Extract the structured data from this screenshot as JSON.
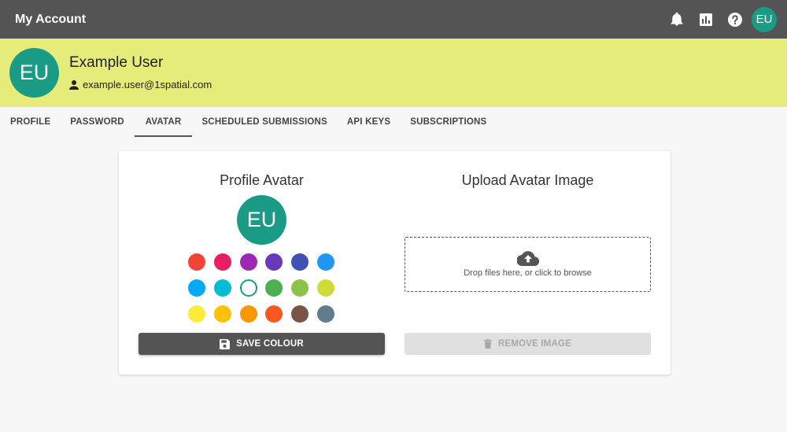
{
  "app": {
    "title": "My Account"
  },
  "topbar": {
    "icons": [
      "bell-icon",
      "chart-icon",
      "help-icon"
    ],
    "avatar_initials": "EU",
    "avatar_color": "#1a9b86"
  },
  "user": {
    "initials": "EU",
    "name": "Example User",
    "email": "example.user@1spatial.com"
  },
  "header_color": "#e6ec7a",
  "tabs": [
    {
      "label": "PROFILE"
    },
    {
      "label": "PASSWORD"
    },
    {
      "label": "AVATAR",
      "active": true
    },
    {
      "label": "SCHEDULED SUBMISSIONS"
    },
    {
      "label": "API KEYS"
    },
    {
      "label": "SUBSCRIPTIONS"
    }
  ],
  "avatar_panel": {
    "title": "Profile Avatar",
    "initials": "EU",
    "swatches": [
      "#f44336",
      "#e91e63",
      "#9c27b0",
      "#673ab7",
      "#3f51b5",
      "#2196f3",
      "#03a9f4",
      "#00bcd4",
      "#1a9b86",
      "#4caf50",
      "#8bc34a",
      "#cddc39",
      "#ffeb3b",
      "#ffc107",
      "#ff9800",
      "#ff5722",
      "#795548",
      "#607d8b"
    ],
    "selected_index": 8,
    "save_label": "SAVE COLOUR"
  },
  "upload_panel": {
    "title": "Upload Avatar Image",
    "dropzone_text": "Drop files here, or click to browse",
    "remove_label": "REMOVE IMAGE"
  }
}
